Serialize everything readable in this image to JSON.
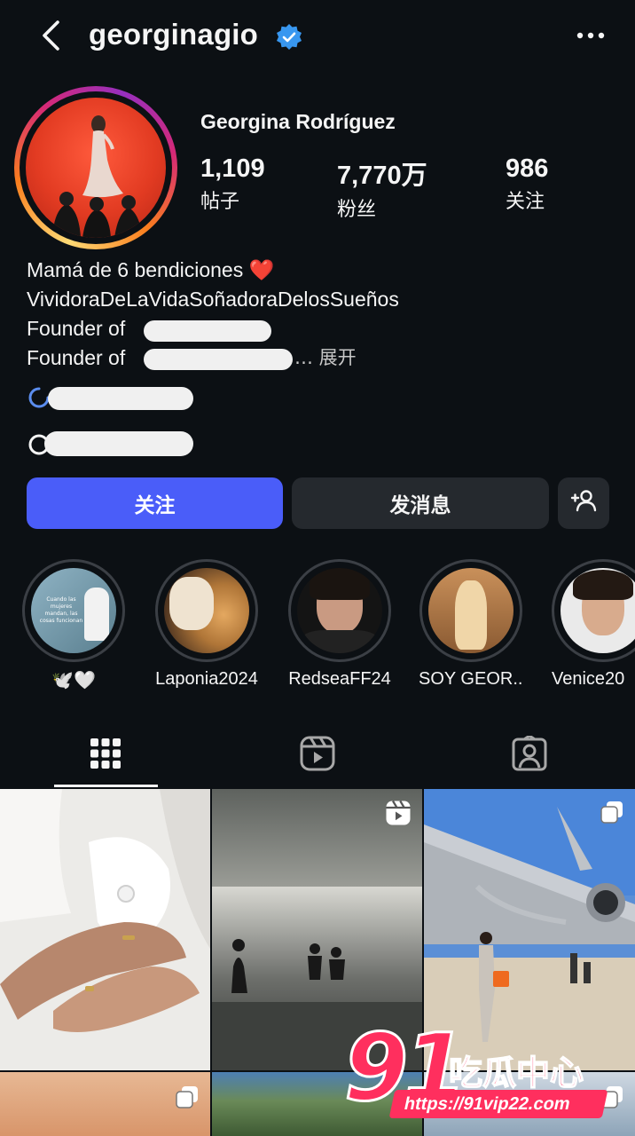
{
  "header": {
    "username": "georginagio",
    "back_icon": "chevron-left-icon",
    "verified_icon": "verified-badge-icon",
    "more_icon": "more-horizontal-icon",
    "verified_color": "#3897f0"
  },
  "profile": {
    "full_name": "Georgina Rodríguez",
    "stats": [
      {
        "value": "1,109",
        "label": "帖子"
      },
      {
        "value": "7,770万",
        "label": "粉丝"
      },
      {
        "value": "986",
        "label": "关注"
      }
    ],
    "bio": {
      "line1": "Mamá de 6 bendiciones ❤️",
      "line2": "VividoraDeLaVidaSoñadoraDelosSueños",
      "line3": "Founder of",
      "line4": "Founder of",
      "expand": "… 展开"
    }
  },
  "actions": {
    "follow_label": "关注",
    "message_label": "发消息",
    "add_user_icon": "add-user-icon",
    "follow_color": "#4a5df9"
  },
  "highlights": [
    {
      "label": "🕊️🤍",
      "image_text": "Cuando las mujeres mandan, las cosas funcionan"
    },
    {
      "label": "Laponia2024"
    },
    {
      "label": "RedseaFF24"
    },
    {
      "label": "SOY GEOR..."
    },
    {
      "label": "Venice20"
    }
  ],
  "tabs": [
    {
      "name": "grid",
      "icon": "grid-icon",
      "active": true
    },
    {
      "name": "reels",
      "icon": "reels-icon",
      "active": false
    },
    {
      "name": "tagged",
      "icon": "tagged-user-icon",
      "active": false
    }
  ],
  "watermark": {
    "number": "91",
    "text": "吃瓜中心",
    "url": "https://91vip22.com"
  }
}
